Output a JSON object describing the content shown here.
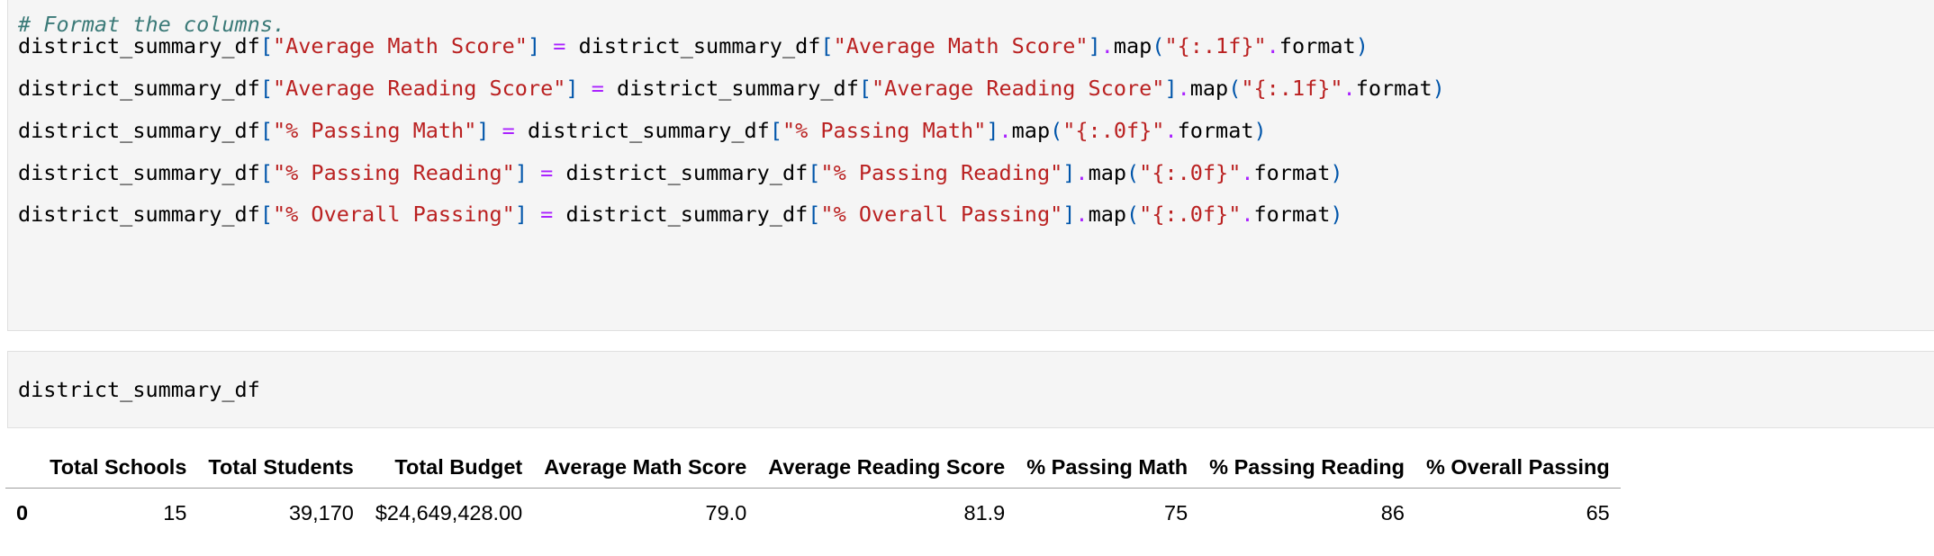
{
  "cell1": {
    "comment": "# Format the columns.",
    "lines": [
      {
        "var": "district_summary_df",
        "key": "\"Average Math Score\"",
        "fmt": "\"{:.1f}\""
      },
      {
        "var": "district_summary_df",
        "key": "\"Average Reading Score\"",
        "fmt": "\"{:.1f}\""
      },
      {
        "var": "district_summary_df",
        "key": "\"% Passing Math\"",
        "fmt": "\"{:.0f}\""
      },
      {
        "var": "district_summary_df",
        "key": "\"% Passing Reading\"",
        "fmt": "\"{:.0f}\""
      },
      {
        "var": "district_summary_df",
        "key": "\"% Overall Passing\"",
        "fmt": "\"{:.0f}\""
      }
    ],
    "lbracket": "[",
    "rbracket": "]",
    "eq": "=",
    "dot": ".",
    "map": "map",
    "lparen": "(",
    "rparen": ")",
    "format": "format"
  },
  "cell2": {
    "code": "district_summary_df"
  },
  "table": {
    "columns": [
      "",
      "Total Schools",
      "Total Students",
      "Total Budget",
      "Average Math Score",
      "Average Reading Score",
      "% Passing Math",
      "% Passing Reading",
      "% Overall Passing"
    ],
    "rows": [
      [
        "0",
        "15",
        "39,170",
        "$24,649,428.00",
        "79.0",
        "81.9",
        "75",
        "86",
        "65"
      ]
    ]
  }
}
